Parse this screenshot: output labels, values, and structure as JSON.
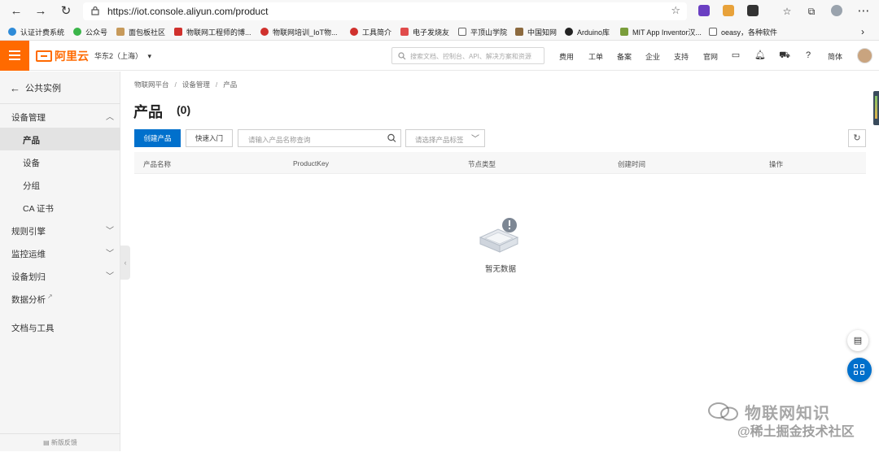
{
  "browser": {
    "url": "https://iot.console.aliyun.com/product",
    "bookmarks": [
      "认证计费系统",
      "公众号",
      "面包板社区",
      "物联网工程师的博...",
      "物联网培训_IoT物...",
      "工具简介",
      "电子发烧友",
      "平顶山学院",
      "中国知网",
      "Arduino库",
      "MIT App Inventor汉...",
      "oeasy，各种软件"
    ]
  },
  "header": {
    "logo": "阿里云",
    "region": "华东2（上海）",
    "search_placeholder": "搜索文档、控制台、API、解决方案和资源",
    "links": [
      "费用",
      "工单",
      "备案",
      "企业",
      "支持",
      "官网"
    ],
    "language": "简体"
  },
  "sidebar": {
    "back_label": "公共实例",
    "items": [
      {
        "label": "设备管理",
        "expandable": true
      },
      {
        "label": "产品",
        "active": true,
        "sub": true
      },
      {
        "label": "设备",
        "sub": true
      },
      {
        "label": "分组",
        "sub": true
      },
      {
        "label": "CA 证书",
        "sub": true
      },
      {
        "label": "规则引擎",
        "expandable": true
      },
      {
        "label": "监控运维",
        "expandable": true
      },
      {
        "label": "设备划归",
        "expandable": true
      },
      {
        "label": "数据分析",
        "external": true
      },
      {
        "label": "文档与工具"
      }
    ],
    "feedback": "新版反馈"
  },
  "main": {
    "breadcrumb": [
      "物联网平台",
      "设备管理",
      "产品"
    ],
    "title": "产品",
    "count": "(0)",
    "create_button": "创建产品",
    "quick_start_button": "快速入门",
    "search_placeholder": "请输入产品名称查询",
    "tag_select_placeholder": "请选择产品标签",
    "columns": [
      "产品名称",
      "ProductKey",
      "节点类型",
      "创建时间",
      "操作"
    ],
    "empty_text": "暂无数据"
  },
  "watermark": {
    "line1": "物联网知识",
    "line2": "@稀土掘金技术社区"
  }
}
